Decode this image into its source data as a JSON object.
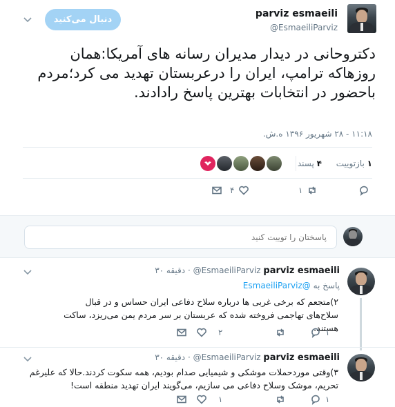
{
  "main_tweet": {
    "author_name": "parviz esmaeili",
    "author_handle": "@EsmaeiliParviz",
    "follow_label": "دنبال می‌کنید",
    "text": "دکتروحانی در دیدار مدیران رسانه های آمریکا:همان روزهاکه ترامپ، ایران را درعربستان تهدید می کرد؛مردم باحضور در انتخابات بهترین پاسخ رادادند.",
    "timestamp": "۱۱:۱۸ - ۲۸ شهریور ۱۳۹۶ ه.ش.",
    "retweets_count": "۱",
    "retweets_label": "بازتوییت",
    "likes_count": "۴",
    "likes_label": "پسند",
    "action_reply_count": "",
    "action_retweet_count": "۱",
    "action_like_count": "۴"
  },
  "reply_box": {
    "placeholder": "پاسختان را توییت کنید"
  },
  "thread": [
    {
      "author_name": "parviz esmaeili",
      "author_handle": "@EsmaeiliParviz",
      "time": "۳۰ دقیقه",
      "reply_to_label": "پاسخ به",
      "reply_to_handle": "@EsmaeiliParviz",
      "text": "۲)متجعم که برخی غربی ها درباره سلاح دفاعی ایران حساس و در قبال سلاح‌های تهاجمی فروخته شده که عربستان بر سر مردم یمن می‌ریزد، ساکت هستند.",
      "reply_count": "",
      "retweet_count": "۱",
      "like_count": "۲"
    },
    {
      "author_name": "parviz esmaeili",
      "author_handle": "@EsmaeiliParviz",
      "time": "۳۰ دقیقه",
      "text": "۳)وقتی موردحملات موشکی و شیمیایی صدام بودیم، همه سکوت کردند.حالا که علیرغم تحریم، موشک وسلاح دفاعی می سازیم، می‌گویند ایران تهدید منطقه است!",
      "reply_count": "",
      "retweet_count": "۱",
      "like_count": "۱"
    }
  ],
  "colors": {
    "accent": "#1da1f2",
    "follow_bg": "#a3d3f5",
    "muted": "#657786",
    "divider": "#e6ecf0"
  }
}
